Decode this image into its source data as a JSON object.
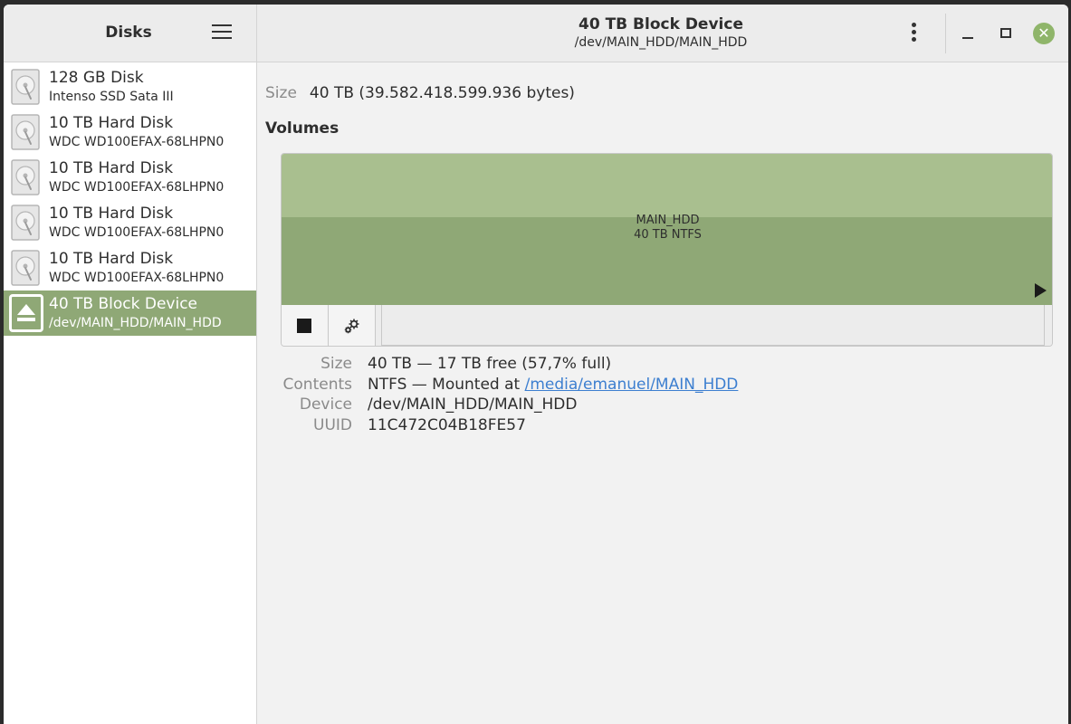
{
  "sidebar": {
    "title": "Disks",
    "items": [
      {
        "name": "128 GB Disk",
        "model": "Intenso SSD Sata III",
        "icon": "hard-disk-icon",
        "selected": false
      },
      {
        "name": "10 TB Hard Disk",
        "model": "WDC WD100EFAX-68LHPN0",
        "icon": "hard-disk-icon",
        "selected": false
      },
      {
        "name": "10 TB Hard Disk",
        "model": "WDC WD100EFAX-68LHPN0",
        "icon": "hard-disk-icon",
        "selected": false
      },
      {
        "name": "10 TB Hard Disk",
        "model": "WDC WD100EFAX-68LHPN0",
        "icon": "hard-disk-icon",
        "selected": false
      },
      {
        "name": "10 TB Hard Disk",
        "model": "WDC WD100EFAX-68LHPN0",
        "icon": "hard-disk-icon",
        "selected": false
      },
      {
        "name": "40 TB Block Device",
        "model": "/dev/MAIN_HDD/MAIN_HDD",
        "icon": "eject-icon",
        "selected": true
      }
    ]
  },
  "header": {
    "title": "40 TB Block Device",
    "subtitle": "/dev/MAIN_HDD/MAIN_HDD",
    "close_glyph": "✕"
  },
  "device": {
    "size_label": "Size",
    "size_value": "40 TB (39.582.418.599.936 bytes)"
  },
  "volumes": {
    "heading": "Volumes",
    "partition_name": "MAIN_HDD",
    "partition_desc": "40 TB NTFS"
  },
  "volume_props": {
    "size_label": "Size",
    "size_value": "40 TB — 17 TB free (57,7% full)",
    "contents_label": "Contents",
    "contents_prefix": "NTFS — Mounted at ",
    "contents_link": "/media/emanuel/MAIN_HDD",
    "device_label": "Device",
    "device_value": "/dev/MAIN_HDD/MAIN_HDD",
    "uuid_label": "UUID",
    "uuid_value": "11C472C04B18FE57"
  },
  "colors": {
    "accent": "#8fa876",
    "partition_top": "#a9bf8f",
    "close_button": "#8fb56a",
    "link": "#3d7fd0"
  }
}
